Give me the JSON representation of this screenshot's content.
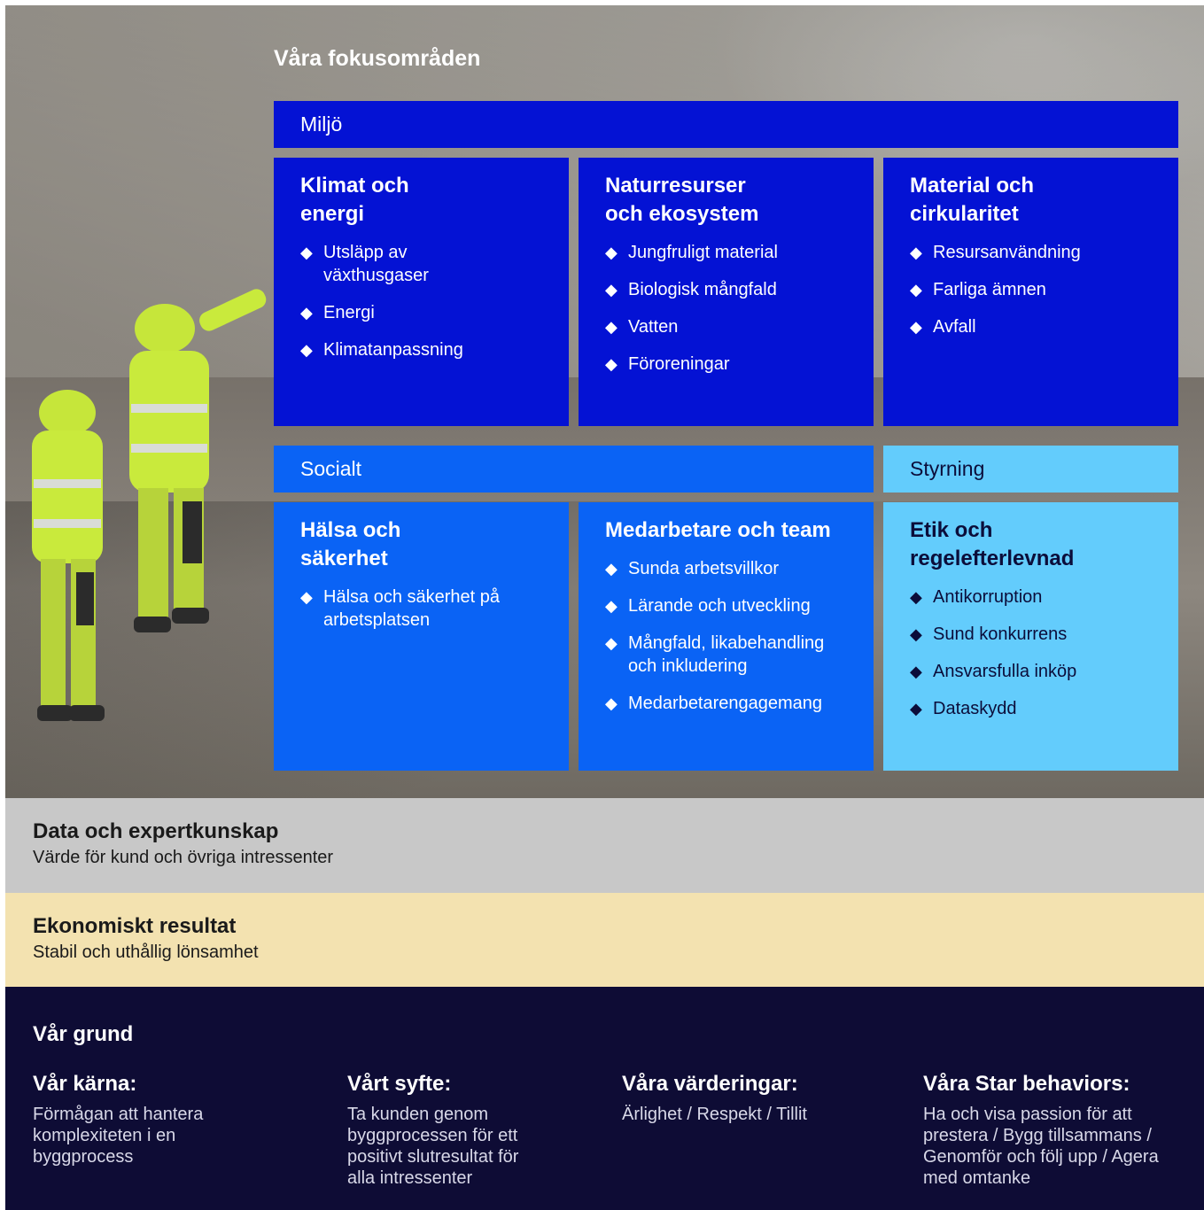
{
  "title": "Våra fokusområden",
  "colors": {
    "environment": "#0412d4",
    "social": "#0a63f5",
    "governance": "#63ccfc",
    "data_strip": "#c8c8c8",
    "economy_strip": "#f3e2b0",
    "foundation": "#0e0c35"
  },
  "bands": {
    "environment": "Miljö",
    "social": "Socialt",
    "governance": "Styrning"
  },
  "cards": {
    "klimat": {
      "title": "Klimat och energi",
      "items": [
        "Utsläpp av växthusgaser",
        "Energi",
        "Klimatanpassning"
      ]
    },
    "natur": {
      "title": "Naturresurser och ekosystem",
      "items": [
        "Jungfruligt material",
        "Biologisk mångfald",
        "Vatten",
        "Föroreningar"
      ]
    },
    "material": {
      "title": "Material och cirkularitet",
      "items": [
        "Resursanvändning",
        "Farliga ämnen",
        "Avfall"
      ]
    },
    "halsa": {
      "title": "Hälsa och säkerhet",
      "items": [
        "Hälsa och säkerhet på arbetsplatsen"
      ]
    },
    "medarbetare": {
      "title": "Medarbetare och team",
      "items": [
        "Sunda arbetsvillkor",
        "Lärande och utveckling",
        "Mångfald, likabehandling och inkludering",
        "Medarbetarengagemang"
      ]
    },
    "etik": {
      "title": "Etik och regelefterlevnad",
      "items": [
        "Antikorruption",
        "Sund konkurrens",
        "Ansvarsfulla inköp",
        "Dataskydd"
      ]
    }
  },
  "data_strip": {
    "title": "Data och expertkunskap",
    "subtitle": "Värde för kund och övriga intressenter"
  },
  "economy_strip": {
    "title": "Ekonomiskt resultat",
    "subtitle": "Stabil och uthållig lönsamhet"
  },
  "foundation": {
    "title": "Vår grund",
    "columns": [
      {
        "title": "Vår kärna:",
        "text": "Förmågan att hantera komplexiteten i en byggprocess"
      },
      {
        "title": "Vårt syfte:",
        "text": "Ta kunden genom byggprocessen för ett positivt slutresultat för alla intressenter"
      },
      {
        "title": "Våra värderingar:",
        "text": "Ärlighet / Respekt / Tillit"
      },
      {
        "title": "Våra Star behaviors:",
        "text": "Ha och visa passion för att prestera / Bygg tillsammans / Genomför och följ upp / Agera med omtanke"
      }
    ]
  }
}
